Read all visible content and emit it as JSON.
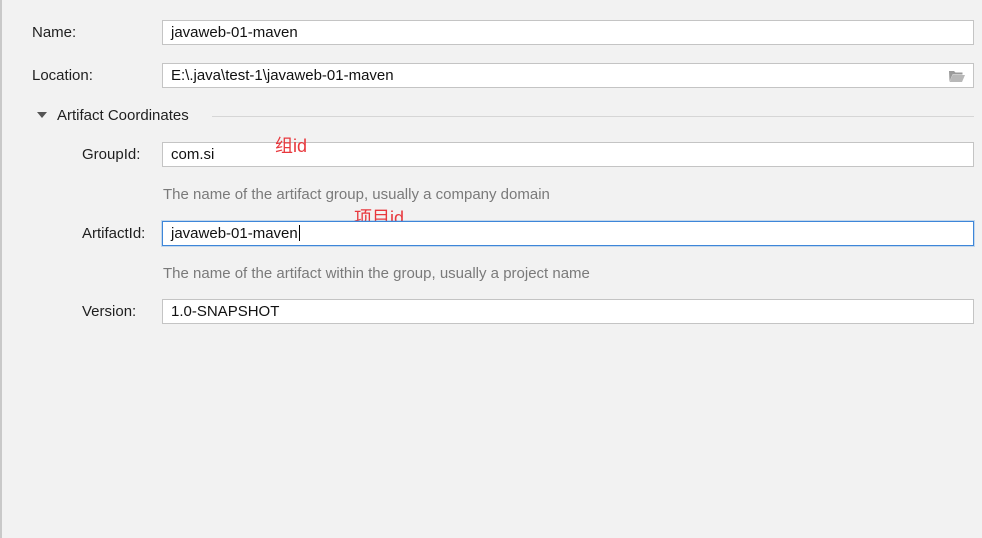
{
  "form": {
    "name": {
      "label": "Name:",
      "value": "javaweb-01-maven"
    },
    "location": {
      "label": "Location:",
      "value": "E:\\.java\\test-1\\javaweb-01-maven",
      "browse_icon": "folder-open-icon"
    },
    "section": {
      "title": "Artifact Coordinates",
      "toggle_icon": "triangle-down-icon"
    },
    "group_id": {
      "label": "GroupId:",
      "value": "com.si",
      "hint": "The name of the artifact group, usually a company domain",
      "annotation": "组id"
    },
    "artifact_id": {
      "label": "ArtifactId:",
      "value": "javaweb-01-maven",
      "hint": "The name of the artifact within the group, usually a project name",
      "annotation": "项目id"
    },
    "version": {
      "label": "Version:",
      "value": "1.0-SNAPSHOT"
    }
  },
  "colors": {
    "background": "#f2f2f2",
    "focus_border": "#3d86d9",
    "annotation": "#e8383d",
    "hint_text": "#7a7a7a"
  }
}
